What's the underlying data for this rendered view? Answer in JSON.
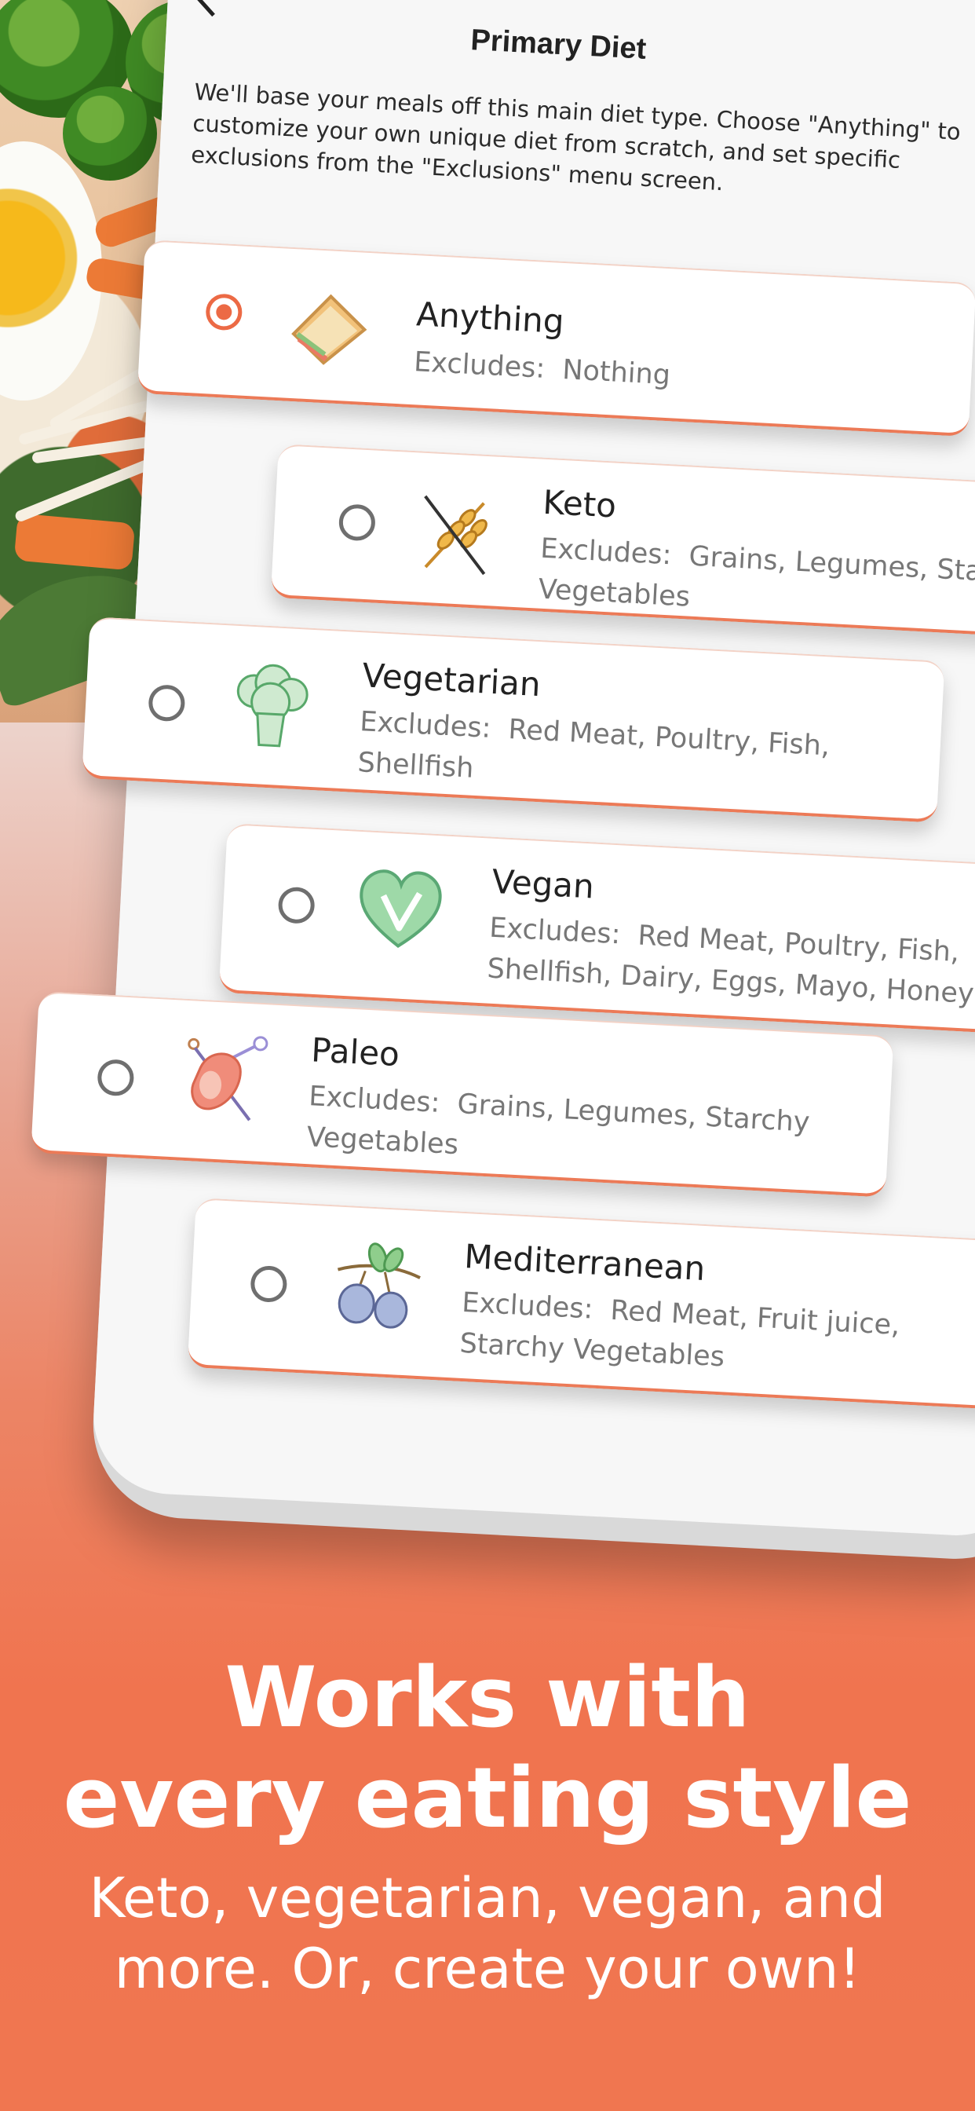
{
  "screen": {
    "title": "Primary Diet",
    "description": "We'll base your meals off this main diet type. Choose \"Anything\" to customize your own unique diet from scratch, and set specific exclusions from the \"Exclusions\" menu screen."
  },
  "diets": [
    {
      "name": "Anything",
      "excludes_label": "Excludes:",
      "excludes": "Nothing",
      "selected": true,
      "icon": "sandwich-icon"
    },
    {
      "name": "Keto",
      "excludes_label": "Excludes:",
      "excludes": "Grains, Legumes, Starchy Vegetables",
      "selected": false,
      "icon": "no-wheat-icon"
    },
    {
      "name": "Vegetarian",
      "excludes_label": "Excludes:",
      "excludes": "Red Meat, Poultry, Fish, Shellfish",
      "selected": false,
      "icon": "broccoli-icon"
    },
    {
      "name": "Vegan",
      "excludes_label": "Excludes:",
      "excludes": "Red Meat, Poultry, Fish, Shellfish, Dairy, Eggs, Mayo, Honey",
      "selected": false,
      "icon": "vegan-heart-icon"
    },
    {
      "name": "Paleo",
      "excludes_label": "Excludes:",
      "excludes": "Grains, Legumes, Starchy Vegetables",
      "selected": false,
      "icon": "meat-drumstick-icon"
    },
    {
      "name": "Mediterranean",
      "excludes_label": "Excludes:",
      "excludes": "Red Meat, Fruit juice, Starchy Vegetables",
      "selected": false,
      "icon": "olive-branch-icon"
    }
  ],
  "promo": {
    "headline_line1": "Works with",
    "headline_line2": "every eating style",
    "subline_line1": "Keto, vegetarian, vegan, and",
    "subline_line2": "more. Or, create your own!"
  },
  "colors": {
    "accent": "#ec6a45",
    "background_bottom": "#f07650",
    "radio_unselected": "#6f6f6f"
  }
}
